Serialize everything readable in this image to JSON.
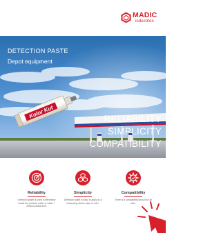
{
  "brand": {
    "name": "MADIC",
    "sub": "industries",
    "color": "#d8202c"
  },
  "hero": {
    "title": "DETECTION PASTE",
    "subtitle": "Depot equipment",
    "taglines": [
      "RELIABILITY",
      "SIMPLICITY",
      "COMPATIBILITY"
    ],
    "product_label": "Kolor Kut"
  },
  "features": [
    {
      "name": "Reliability",
      "icon": "target-icon",
      "description": "Detection paste is used to effectively locate the product: water or water + ethanol phase limit."
    },
    {
      "name": "Simplicity",
      "icon": "cubes-icon",
      "description": "Detection paste is easy to apply to a measuring ribbon, tape or ruler."
    },
    {
      "name": "Compatibility",
      "icon": "gear-icon",
      "description": "There is a compatible product for all uses."
    }
  ]
}
